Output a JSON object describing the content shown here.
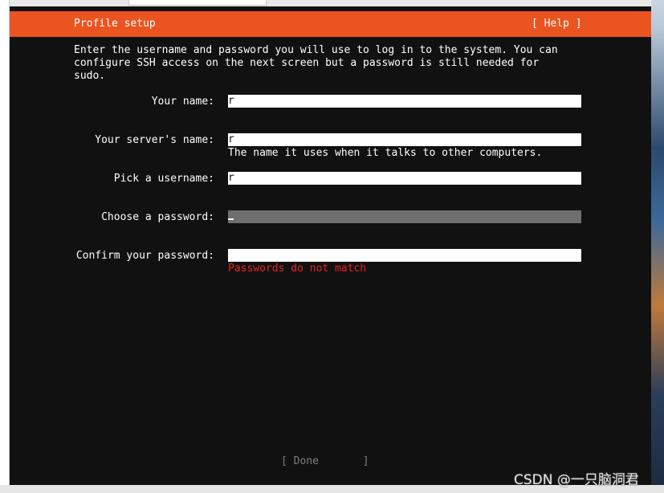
{
  "window": {
    "title": "Profile setup",
    "help_label": "[ Help ]"
  },
  "intro_text": "Enter the username and password you will use to log in to the system. You can\nconfigure SSH access on the next screen but a password is still needed for\nsudo.",
  "form": {
    "your_name": {
      "label": "Your name:",
      "value": "r"
    },
    "server_name": {
      "label": "Your server's name:",
      "value": "r",
      "hint": "The name it uses when it talks to other computers."
    },
    "username": {
      "label": "Pick a username:",
      "value": "r"
    },
    "password": {
      "label": "Choose a password:",
      "value": ""
    },
    "confirm_password": {
      "label": "Confirm your password:",
      "value": "",
      "error": "Passwords do not match"
    }
  },
  "done_label": "[ Done       ]",
  "watermark": "CSDN @一只脑洞君",
  "colors": {
    "accent": "#e95420",
    "background": "#111111",
    "error": "#e62222",
    "focused_field": "#6f6f6f"
  }
}
